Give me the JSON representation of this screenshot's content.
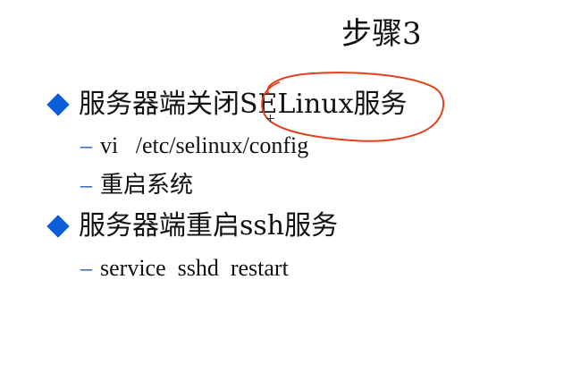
{
  "slide": {
    "title": "步骤3",
    "bullets": [
      {
        "text": "服务器端关闭SELinux服务",
        "subitems": [
          "vi   /etc/selinux/config",
          "重启系统"
        ]
      },
      {
        "text": "服务器端重启ssh服务",
        "subitems": [
          "service  sshd  restart"
        ]
      }
    ],
    "sub_dash": "–"
  },
  "colors": {
    "bullet_diamond": "#0a5fd8",
    "dash": "#1a4fbf",
    "annotation_ellipse": "#e0421c"
  }
}
